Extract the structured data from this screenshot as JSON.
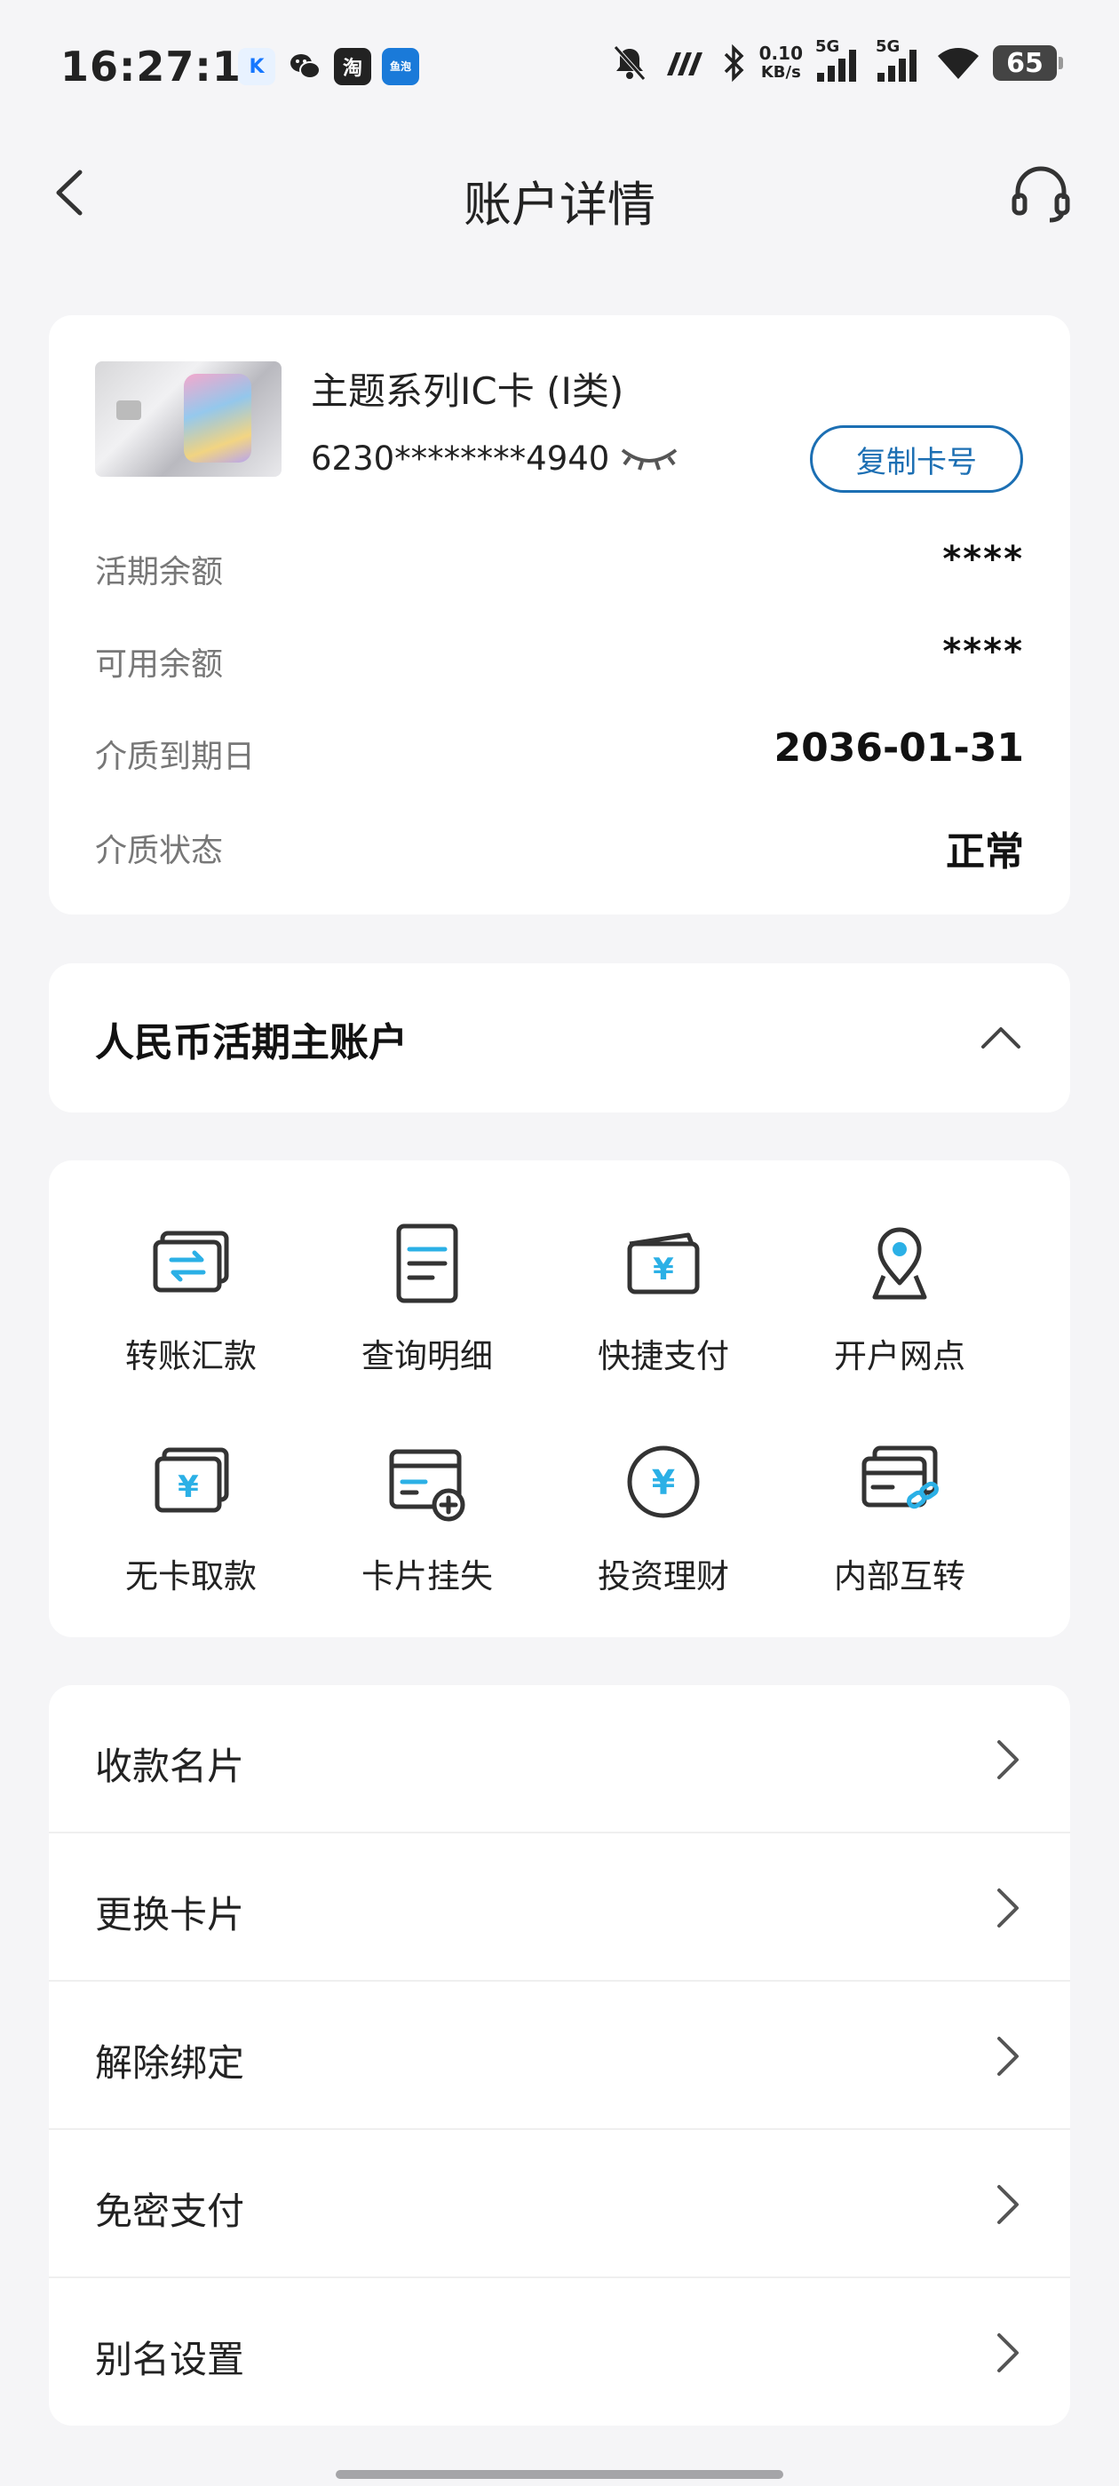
{
  "status_bar": {
    "time": "16:27:12",
    "app_icons": [
      {
        "name": "kuaishou-icon",
        "glyph": "K",
        "color": "#1677ff"
      },
      {
        "name": "wechat-icon",
        "glyph": "●",
        "color": "#222222"
      },
      {
        "name": "taobao-icon",
        "glyph": "淘",
        "color": "#222222"
      },
      {
        "name": "yupao-icon",
        "glyph": "鱼泡",
        "color": "#1a7ad9"
      }
    ],
    "net_speed_value": "0.10",
    "net_speed_unit": "KB/s",
    "signal_1_label": "5G",
    "signal_2_label": "5G",
    "battery": "65"
  },
  "header": {
    "title": "账户详情"
  },
  "account": {
    "card_name": "主题系列IC卡 (I类)",
    "card_number": "6230********4940",
    "copy_button": "复制卡号",
    "rows": [
      {
        "label": "活期余额",
        "value": "****"
      },
      {
        "label": "可用余额",
        "value": "****"
      },
      {
        "label": "介质到期日",
        "value": "2036-01-31"
      },
      {
        "label": "介质状态",
        "value": "正常"
      }
    ]
  },
  "section": {
    "title": "人民币活期主账户"
  },
  "functions": [
    {
      "label": "转账汇款",
      "icon": "transfer-icon"
    },
    {
      "label": "查询明细",
      "icon": "details-icon"
    },
    {
      "label": "快捷支付",
      "icon": "quick-pay-icon"
    },
    {
      "label": "开户网点",
      "icon": "location-icon"
    },
    {
      "label": "无卡取款",
      "icon": "cardless-withdraw-icon"
    },
    {
      "label": "卡片挂失",
      "icon": "card-loss-icon"
    },
    {
      "label": "投资理财",
      "icon": "investment-icon"
    },
    {
      "label": "内部互转",
      "icon": "internal-transfer-icon"
    }
  ],
  "menu": [
    {
      "label": "收款名片"
    },
    {
      "label": "更换卡片"
    },
    {
      "label": "解除绑定"
    },
    {
      "label": "免密支付"
    },
    {
      "label": "别名设置"
    }
  ],
  "colors": {
    "accent_blue": "#1c6fb3",
    "icon_cyan": "#2bb0e6",
    "icon_dark": "#333333"
  }
}
